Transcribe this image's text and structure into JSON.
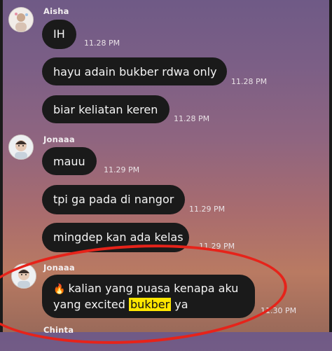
{
  "messages_group1": {
    "sender": "Aisha",
    "items": [
      {
        "text": "IH",
        "time": "11.28 PM"
      },
      {
        "text": "hayu adain bukber rdwa only",
        "time": "11.28 PM"
      },
      {
        "text": "biar keliatan keren",
        "time": "11.28 PM"
      }
    ]
  },
  "messages_group2": {
    "sender": "Jonaaa",
    "items": [
      {
        "text": "mauu",
        "time": "11.29 PM"
      },
      {
        "text": "tpi ga pada di nangor",
        "time": "11.29 PM"
      },
      {
        "text": "mingdep kan ada kelas",
        "time": "11.29 PM"
      }
    ]
  },
  "messages_group3": {
    "sender": "Jonaaa",
    "line1": "kalian yang puasa kenapa aku",
    "line2_pre": "yang excited ",
    "line2_highlight": "bukber",
    "line2_post": " ya",
    "time": "11.30 PM",
    "emoji_icon": "fire-emoji-icon"
  },
  "next_sender": "Chinta"
}
